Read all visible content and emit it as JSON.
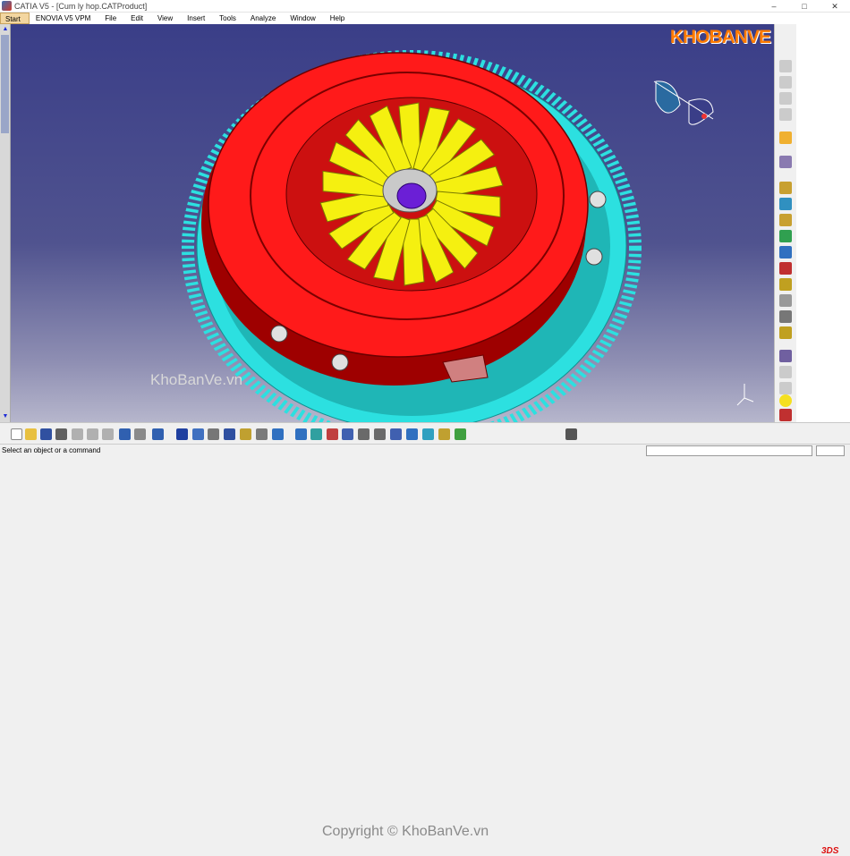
{
  "window": {
    "title": "CATIA V5 - [Cum ly hop.CATProduct]",
    "controls": [
      "–",
      "□",
      "✕"
    ]
  },
  "menu": {
    "items": [
      "Start",
      "ENOVIA V5 VPM",
      "File",
      "Edit",
      "View",
      "Insert",
      "Tools",
      "Analyze",
      "Window",
      "Help"
    ]
  },
  "watermark": {
    "logo": "KHOBANVE",
    "site": "KhoBanVe.vn",
    "copyright": "Copyright © KhoBanVe.vn"
  },
  "status": {
    "message": "Select an object or a command",
    "command_value": "",
    "brand": "3DS"
  },
  "colors": {
    "cover": "#ff1a1a",
    "cover_dark": "#9e0000",
    "fingers": "#f5f010",
    "ring_gear": "#2ce0e0",
    "hub": "#6b1fd6",
    "background_top": "#3a3e88",
    "background_bottom": "#b6b6cc"
  },
  "right_toolbar": {
    "icons": [
      "product-icon-1",
      "product-icon-2",
      "product-icon-3",
      "product-icon-4",
      "select-arrow-icon",
      "snap-icon",
      "assembly-icon-1",
      "assembly-icon-2",
      "assembly-icon-3",
      "assembly-icon-4",
      "constraint-icon-1",
      "constraint-icon-2",
      "constraint-icon-3",
      "constraint-icon-4",
      "constraint-icon-5",
      "constraint-icon-6",
      "analysis-icon-1",
      "analysis-icon-2",
      "analysis-icon-3",
      "bulb-icon",
      "bug-icon"
    ]
  },
  "bottom_toolbar": {
    "icons": [
      "new-icon",
      "open-icon",
      "save-icon",
      "print-icon",
      "cut-icon",
      "copy-icon",
      "paste-icon",
      "undo-icon",
      "redo-icon",
      "help-icon",
      "formula-icon",
      "comment-icon",
      "grid-icon",
      "table-icon",
      "catalog-icon",
      "measure-icon",
      "tools-icon",
      "fly-icon",
      "fit-all-icon",
      "pan-icon",
      "rotate-icon",
      "zoom-in-icon",
      "zoom-out-icon",
      "normal-view-icon",
      "iso-view-icon",
      "render-icon",
      "hide-icon",
      "swap-icon",
      "camera-icon"
    ]
  }
}
